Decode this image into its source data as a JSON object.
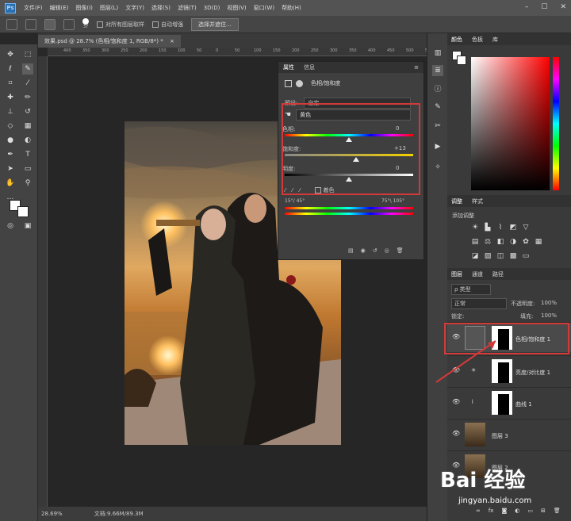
{
  "app": {
    "logo": "Ps"
  },
  "menu": [
    "文件(F)",
    "编辑(E)",
    "图像(I)",
    "图层(L)",
    "文字(Y)",
    "选择(S)",
    "滤镜(T)",
    "3D(D)",
    "视图(V)",
    "窗口(W)",
    "帮助(H)"
  ],
  "options": {
    "brush_size": "37",
    "sample_all_layers": "对所有图层取样",
    "auto_enhance": "自动增强",
    "select_mask_button": "选择并遮住..."
  },
  "document": {
    "tab_title": "效果.psd @ 28.7% (色相/饱和度 1, RGB/8*) *",
    "zoom": "28.69%",
    "doc_size": "文档:9.66M/89.3M"
  },
  "ruler_h": [
    "400",
    "350",
    "300",
    "250",
    "200",
    "150",
    "100",
    "50",
    "0",
    "50",
    "100",
    "150",
    "200",
    "250",
    "300",
    "350",
    "400",
    "450",
    "500",
    "550"
  ],
  "properties": {
    "tabs": [
      "属性",
      "信息"
    ],
    "title": "色相/饱和度",
    "preset_label": "预设:",
    "preset_value": "自定",
    "channel": "黄色",
    "hue_label": "色相:",
    "hue_value": "0",
    "saturation_label": "饱和度:",
    "saturation_value": "+13",
    "lightness_label": "明度:",
    "lightness_value": "0",
    "colorize": "着色",
    "range_left": "15°/ 45°",
    "range_right": "75°\\ 105°"
  },
  "color_panel": {
    "tabs": [
      "颜色",
      "色板",
      "库"
    ]
  },
  "adjust_panel": {
    "tabs": [
      "调整",
      "样式"
    ],
    "title": "添加调整"
  },
  "layers_panel": {
    "tabs": [
      "图层",
      "通道",
      "路径"
    ],
    "filter_kind": "ρ 类型",
    "blend_mode": "正常",
    "opacity_label": "不透明度:",
    "opacity_value": "100%",
    "lock_label": "锁定:",
    "fill_label": "填充:",
    "fill_value": "100%",
    "layers": [
      {
        "name": "色相/饱和度 1"
      },
      {
        "name": "亮度/对比度 1"
      },
      {
        "name": "曲线 1"
      },
      {
        "name": "图层 3"
      },
      {
        "name": "图层 2"
      }
    ]
  },
  "watermark": {
    "brand": "Bai 经验",
    "url": "jingyan.baidu.com"
  },
  "colors": {
    "accent_red": "#d23a3a",
    "panel_bg": "#3f3f3f",
    "menu_bg": "#535353"
  }
}
